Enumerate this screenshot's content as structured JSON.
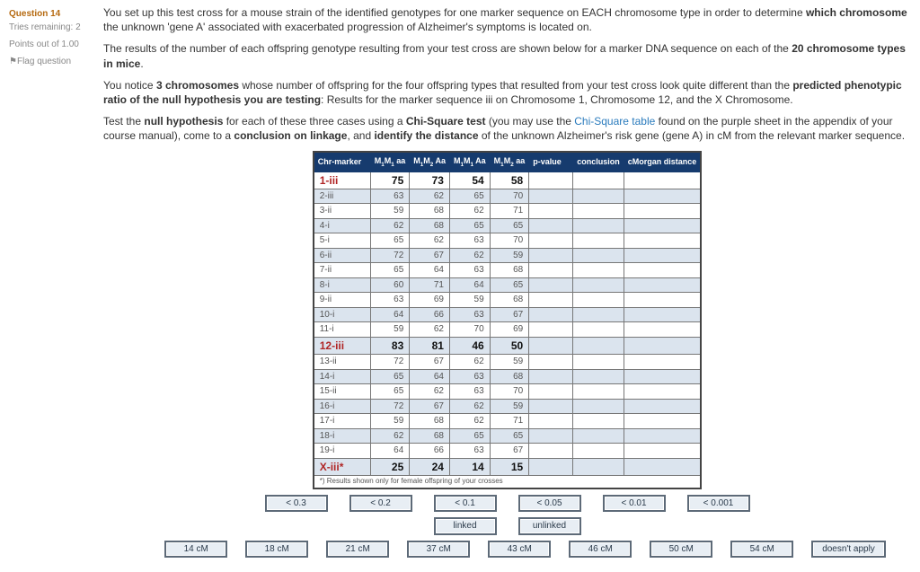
{
  "nav": {
    "question": "Question 14",
    "tries": "Tries remaining: 2",
    "points": "Points out of 1.00",
    "flag": "Flag question"
  },
  "text": {
    "p1a": "You set up this test cross for a mouse strain of the identified genotypes for one marker sequence on EACH chromosome type in order to determine ",
    "p1b": "which chromosome",
    "p1c": " the unknown 'gene A' associated with exacerbated progression of Alzheimer's symptoms is located on.",
    "p2a": "The results of the number of each offspring genotype resulting from your test cross are shown below for a marker DNA sequence on each of the ",
    "p2b": "20 chromosome types in mice",
    "p2c": ".",
    "p3a": "You notice ",
    "p3b": "3 chromosomes",
    "p3c": " whose number of offspring for the four offspring types that resulted from your test cross look quite different than the ",
    "p3d": "predicted phenotypic ratio of the null hypothesis you are testing",
    "p3e": ": Results for the marker sequence iii on Chromosome 1, Chromosome 12, and the X Chromosome.",
    "p4a": "Test the ",
    "p4b": "null hypothesis",
    "p4c": " for each of these three cases using a ",
    "p4d": "Chi-Square test",
    "p4e": " (you may use the ",
    "p4f": "Chi-Square table",
    "p4g": " found on the purple sheet in the appendix of your course manual), come to a ",
    "p4h": "conclusion on linkage",
    "p4i": ", and ",
    "p4j": "identify the distance",
    "p4k": " of the unknown Alzheimer's risk gene (gene A) in cM from the relevant marker sequence."
  },
  "headers": [
    "Chr-marker",
    "M₁M₁ aa",
    "M₁M₂ Aa",
    "M₁M₁ Aa",
    "M₁M₂ aa",
    "p-value",
    "conclusion",
    "cMorgan distance"
  ],
  "rows": [
    {
      "c": "1-iii",
      "v": [
        75,
        73,
        54,
        58
      ],
      "hl": true,
      "in": true
    },
    {
      "c": "2-iii",
      "v": [
        63,
        62,
        65,
        70
      ]
    },
    {
      "c": "3-ii",
      "v": [
        59,
        68,
        62,
        71
      ]
    },
    {
      "c": "4-i",
      "v": [
        62,
        68,
        65,
        65
      ]
    },
    {
      "c": "5-i",
      "v": [
        65,
        62,
        63,
        70
      ]
    },
    {
      "c": "6-ii",
      "v": [
        72,
        67,
        62,
        59
      ]
    },
    {
      "c": "7-ii",
      "v": [
        65,
        64,
        63,
        68
      ]
    },
    {
      "c": "8-i",
      "v": [
        60,
        71,
        64,
        65
      ]
    },
    {
      "c": "9-ii",
      "v": [
        63,
        69,
        59,
        68
      ]
    },
    {
      "c": "10-i",
      "v": [
        64,
        66,
        63,
        67
      ]
    },
    {
      "c": "11-i",
      "v": [
        59,
        62,
        70,
        69
      ]
    },
    {
      "c": "12-iii",
      "v": [
        83,
        81,
        46,
        50
      ],
      "hl": true,
      "in": true
    },
    {
      "c": "13-ii",
      "v": [
        72,
        67,
        62,
        59
      ]
    },
    {
      "c": "14-i",
      "v": [
        65,
        64,
        63,
        68
      ]
    },
    {
      "c": "15-ii",
      "v": [
        65,
        62,
        63,
        70
      ]
    },
    {
      "c": "16-i",
      "v": [
        72,
        67,
        62,
        59
      ]
    },
    {
      "c": "17-i",
      "v": [
        59,
        68,
        62,
        71
      ]
    },
    {
      "c": "18-i",
      "v": [
        62,
        68,
        65,
        65
      ]
    },
    {
      "c": "19-i",
      "v": [
        64,
        66,
        63,
        67
      ]
    },
    {
      "c": "X-iii*",
      "v": [
        25,
        24,
        14,
        15
      ],
      "hl": true,
      "in": true
    }
  ],
  "footnote": "*) Results shown only for female offspring of your crosses",
  "pvals": [
    "< 0.3",
    "< 0.2",
    "< 0.1",
    "< 0.05",
    "< 0.01",
    "< 0.001"
  ],
  "conc": [
    "linked",
    "unlinked"
  ],
  "dist": [
    "14 cM",
    "18 cM",
    "21 cM",
    "37 cM",
    "43 cM",
    "46 cM",
    "50 cM",
    "54 cM",
    "doesn't apply"
  ]
}
